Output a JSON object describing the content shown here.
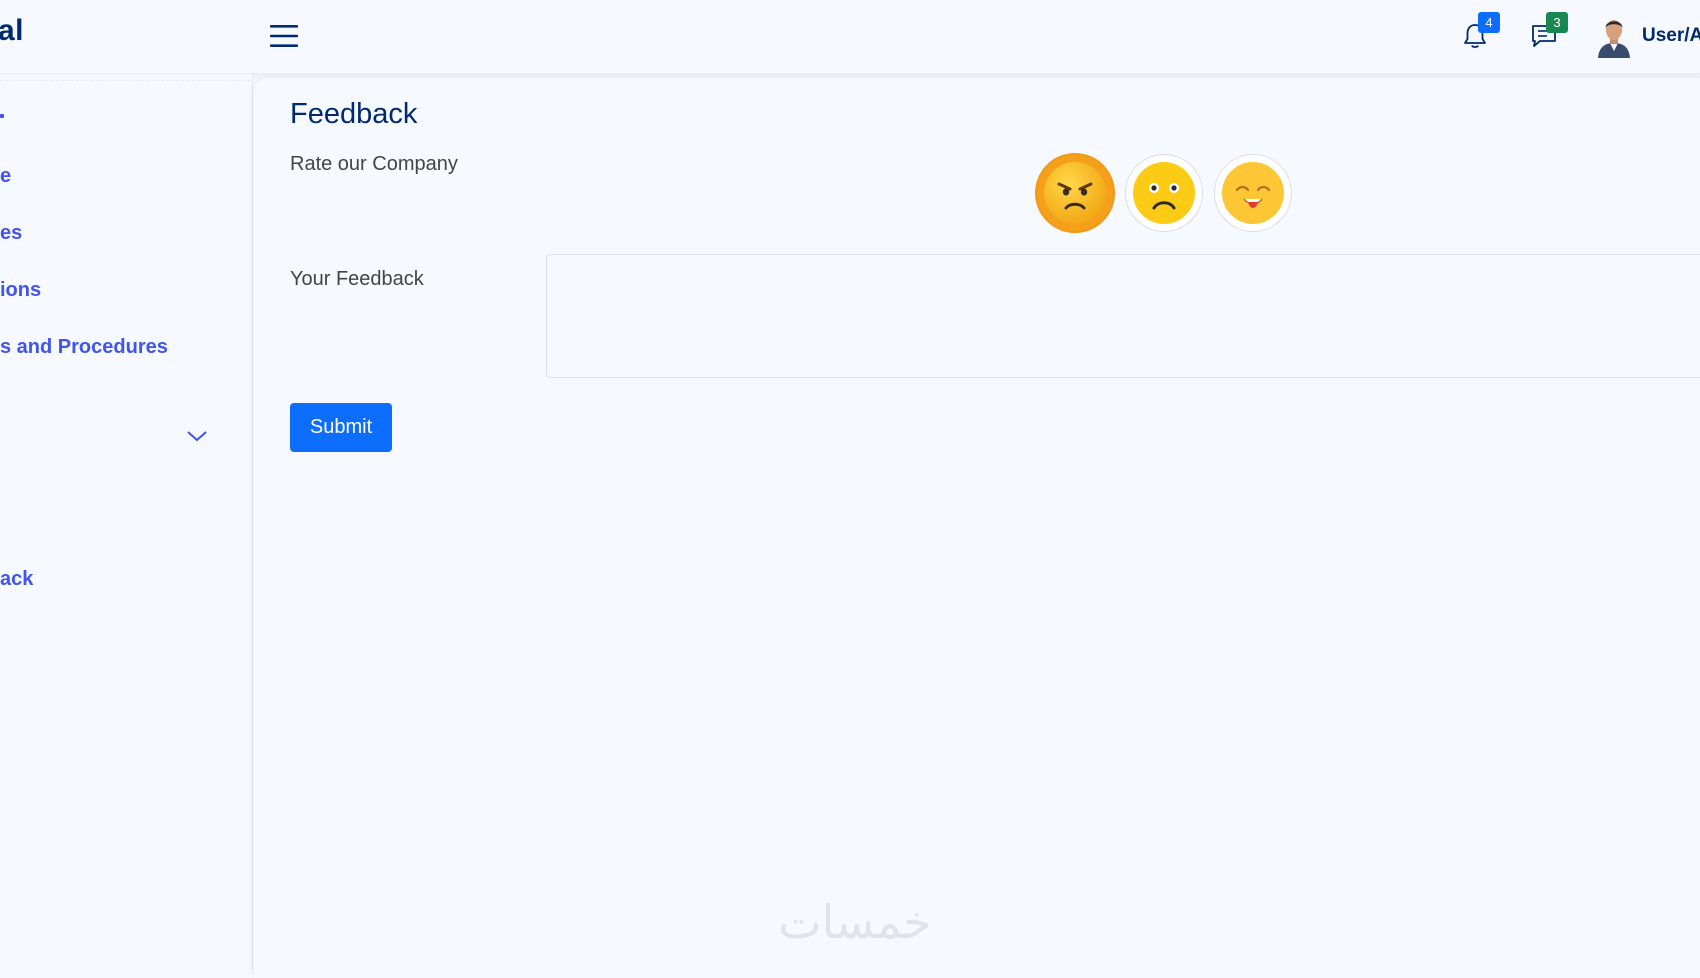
{
  "header": {
    "logo_text": "al",
    "notifications_count": "4",
    "messages_count": "3",
    "profile_name": "User/A"
  },
  "sidebar": {
    "items": [
      {
        "label": "e"
      },
      {
        "label": "es"
      },
      {
        "label": "ions"
      },
      {
        "label": "s and Procedures"
      },
      {
        "label": "ack"
      }
    ]
  },
  "main": {
    "title": "Feedback",
    "rate_label": "Rate our Company",
    "feedback_label": "Your Feedback",
    "feedback_value": "",
    "submit_label": "Submit",
    "ratings": [
      {
        "name": "angry",
        "selected": true
      },
      {
        "name": "sad",
        "selected": false
      },
      {
        "name": "happy",
        "selected": false
      }
    ]
  },
  "watermark": "خمسات",
  "colors": {
    "brand": "#012970",
    "accent": "#4154f1",
    "primary": "#0d6efd",
    "success": "#198754",
    "selected_rating": "#f59f1a"
  }
}
